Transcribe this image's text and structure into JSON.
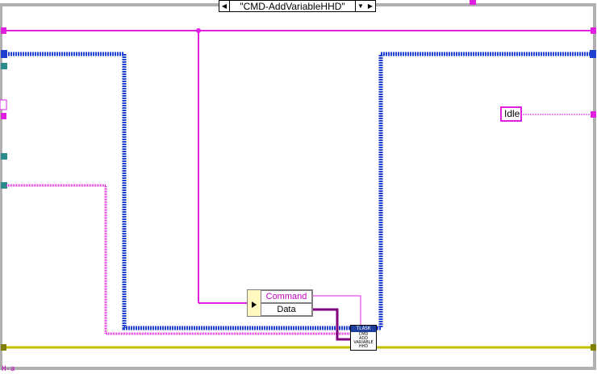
{
  "case_selector": {
    "value": "\"CMD-AddVariableHHD\"",
    "decrement_icon": "triangle-left-icon",
    "increment_icon": "triangle-right-icon",
    "dropdown_icon": "triangle-down-icon"
  },
  "constants": {
    "idle": "Idle"
  },
  "unbundle": {
    "fields": [
      "Command",
      "Data"
    ],
    "arrow_icon": "triangle-right-icon"
  },
  "subvi": {
    "banner": "TLASK",
    "lines": [
      "CMD",
      "ADD",
      "VARIABLE",
      "HHD"
    ]
  },
  "bottom_label": "H-a",
  "colors": {
    "string_wire": "#e020e0",
    "cluster_wire": "#1f3fd0",
    "error_wire": "#c0c000",
    "variant_wire": "#800080",
    "frame": "#b0b0b0"
  }
}
